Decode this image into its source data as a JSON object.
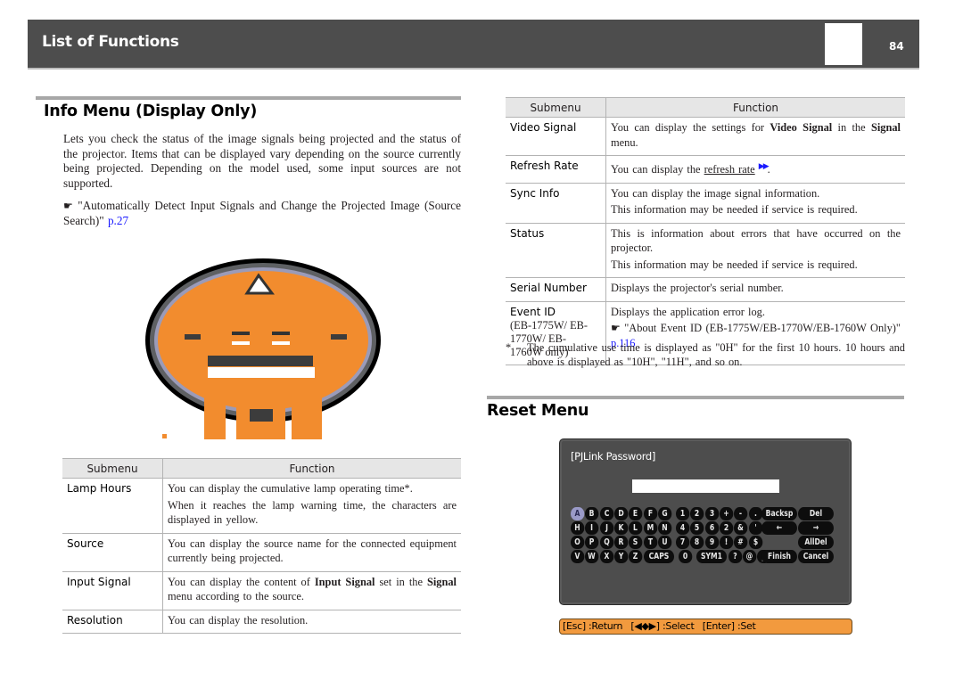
{
  "header": {
    "title": "List of Functions",
    "page_number": "84"
  },
  "info_menu": {
    "title": "Info Menu (Display Only)",
    "intro": "Lets you check the status of the image signals being projected and the status of the projector. Items that can be displayed vary depending on the source currently being projected. Depending on the model used, some input sources are not supported.",
    "reference_icon": "hand-pointer-icon",
    "reference_text": "\"Automatically Detect Input Signals and Change the Projected Image (Source Search)\"",
    "reference_link": "p.27",
    "image_alt": "Info menu OSD screen (low-resolution orange graphic)",
    "table_left": {
      "headers": [
        "Submenu",
        "Function"
      ],
      "rows": [
        {
          "submenu": "Lamp Hours",
          "line1": "You can display the cumulative lamp operating time*.",
          "line2": "When it reaches the lamp warning time, the characters are displayed in yellow."
        },
        {
          "submenu": "Source",
          "line1": "You can display the source name for the connected equipment currently being projected."
        },
        {
          "submenu": "Input Signal",
          "pre": "You can display the content of ",
          "bold1": "Input Signal",
          "mid": " set in the ",
          "bold2": "Signal",
          "post": " menu according to the source."
        },
        {
          "submenu": "Resolution",
          "line1": "You can display the resolution."
        }
      ]
    },
    "table_right": {
      "headers": [
        "Submenu",
        "Function"
      ],
      "rows": [
        {
          "submenu": "Video Signal",
          "pre": "You can display the settings for ",
          "bold1": "Video Signal",
          "mid": " in the ",
          "bold2": "Signal",
          "post": " menu."
        },
        {
          "submenu": "Refresh Rate",
          "pre": "You can display the ",
          "link": "refresh rate",
          "post": "."
        },
        {
          "submenu": "Sync Info",
          "line1": "You can display the image signal information.",
          "line2": "This information may be needed if service is required."
        },
        {
          "submenu": "Status",
          "line1": "This is information about errors that have occurred on the projector.",
          "line2": "This information may be needed if service is required."
        },
        {
          "submenu": "Serial Number",
          "line1": "Displays the projector's serial number."
        },
        {
          "submenu": "Event ID",
          "submenu_note": "(EB-1775W/ EB-1770W/ EB-1760W only)",
          "line1": "Displays the application error log.",
          "ref_text": "\"About Event ID (EB-1775W/EB-1770W/EB-1760W Only)\"",
          "ref_link": "p.116"
        }
      ]
    },
    "footnote": {
      "mark": "*",
      "text": "The cumulative use time is displayed as \"0H\" for the first 10 hours. 10 hours and above is displayed as \"10H\", \"11H\", and so on."
    }
  },
  "reset_menu": {
    "title": "Reset Menu",
    "osd": {
      "title": "[PJLink Password]",
      "password_value": "",
      "keys": [
        [
          "A",
          "B",
          "C",
          "D",
          "E",
          "F",
          "G",
          "1",
          "2",
          "3",
          "+",
          "-",
          "."
        ],
        [
          "H",
          "I",
          "J",
          "K",
          "L",
          "M",
          "N",
          "4",
          "5",
          "6",
          "2",
          "&",
          "'"
        ],
        [
          "O",
          "P",
          "Q",
          "R",
          "S",
          "T",
          "U",
          "7",
          "8",
          "9",
          "!",
          "#",
          "$"
        ],
        [
          "V",
          "W",
          "X",
          "Y",
          "Z",
          "CAPS",
          "0",
          "SYM1",
          "?",
          "@",
          "_"
        ]
      ],
      "selected_key": "A",
      "function_keys": {
        "backspace": "Backsp",
        "delete": "Del",
        "left": "←",
        "right": "→",
        "all_delete": "AllDel",
        "finish": "Finish",
        "cancel": "Cancel"
      },
      "help": {
        "esc": "[Esc] :Return",
        "select": "[◀◆▶] :Select",
        "enter": "[Enter] :Set"
      },
      "colors": {
        "panel": "#4d4d4d",
        "key": "#0d0d0d",
        "selected_key": "#9a9ac8",
        "help_bar": "#f29a3e"
      }
    }
  }
}
